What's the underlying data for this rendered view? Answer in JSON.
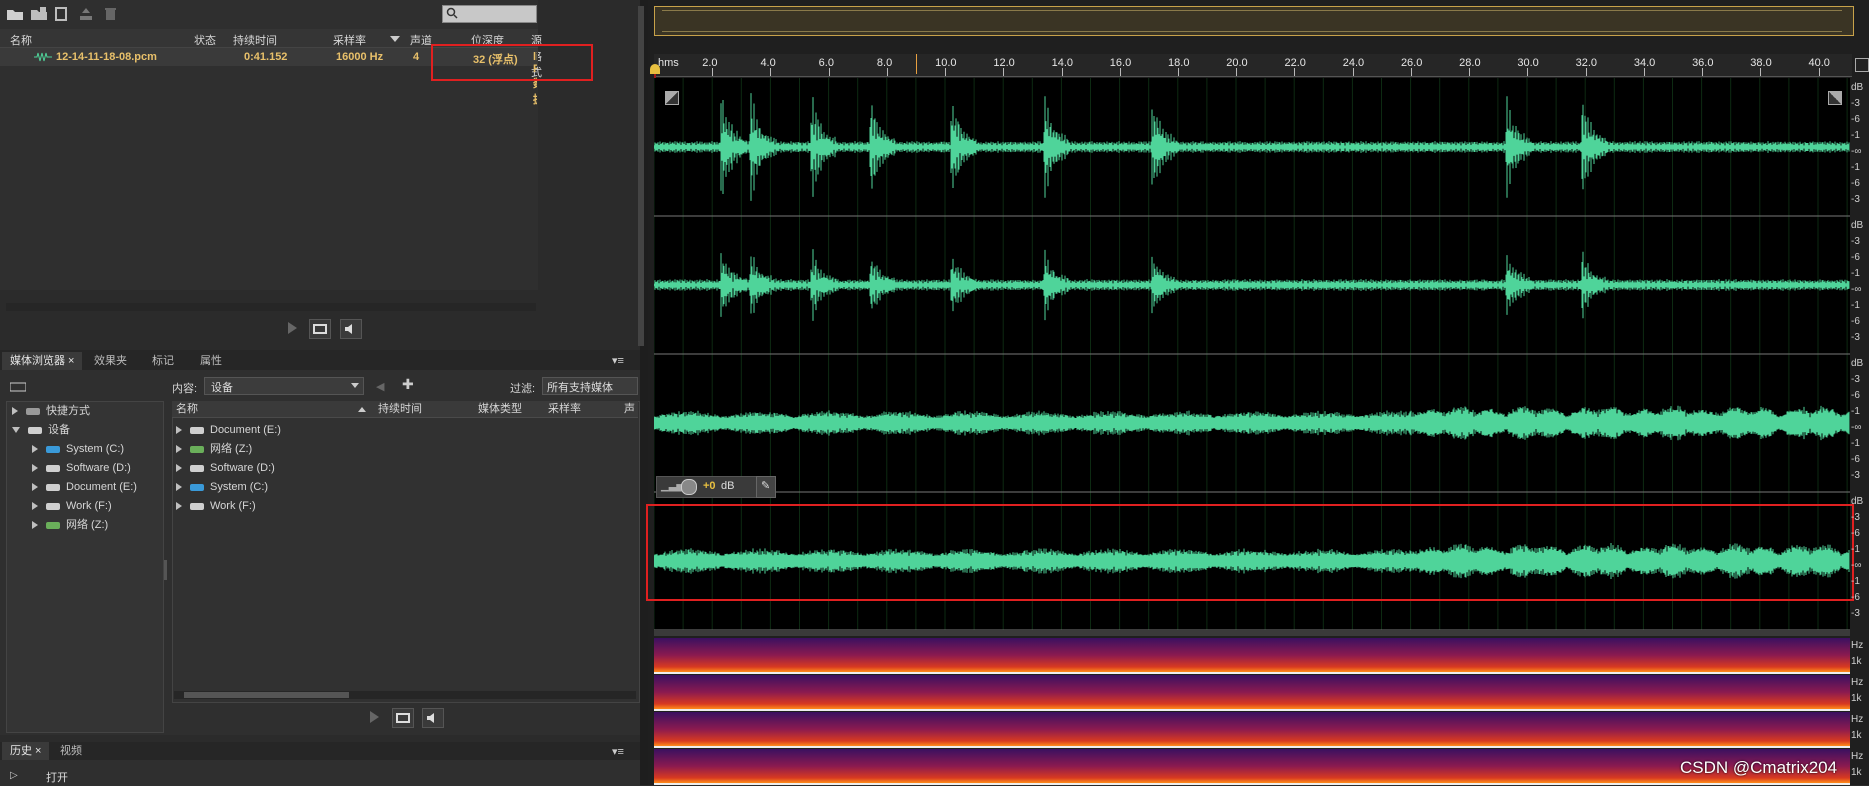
{
  "files_panel": {
    "search_placeholder": "",
    "columns": [
      "名称",
      "状态",
      "持续时间",
      "采样率",
      "声道",
      "位深度",
      "源格式"
    ],
    "row": {
      "name": "12-14-11-18-08.pcm",
      "status": "",
      "duration": "0:41.152",
      "sample_rate": "16000 Hz",
      "channels": "4",
      "bit_depth": "32 (浮点)",
      "format": "libsndfile: Raw数据,"
    }
  },
  "browser_panel": {
    "tabs": [
      "媒体浏览器",
      "效果夹",
      "标记",
      "属性"
    ],
    "content_label": "内容:",
    "content_value": "设备",
    "filter_label": "过滤:",
    "filter_value": "所有支持媒体",
    "tree": {
      "shortcuts": "快捷方式",
      "devices": "设备",
      "drives": [
        "System (C:)",
        "Software (D:)",
        "Document (E:)",
        "Work (F:)",
        "网络 (Z:)"
      ]
    },
    "list_columns": [
      "名称",
      "持续时间",
      "媒体类型",
      "采样率",
      "声"
    ],
    "list_items": [
      "Document (E:)",
      "网络 (Z:)",
      "Software (D:)",
      "System (C:)",
      "Work (F:)"
    ]
  },
  "history_panel": {
    "tabs": [
      "历史",
      "视频"
    ],
    "items": [
      "打开"
    ]
  },
  "editor": {
    "ruler_unit": "hms",
    "ruler_ticks": [
      "2.0",
      "4.0",
      "6.0",
      "8.0",
      "10.0",
      "12.0",
      "14.0",
      "16.0",
      "18.0",
      "20.0",
      "22.0",
      "24.0",
      "26.0",
      "28.0",
      "30.0",
      "32.0",
      "34.0",
      "36.0",
      "38.0",
      "40.0"
    ],
    "db_labels": [
      "dB",
      "-3",
      "-6",
      "-1",
      "-∞",
      "-1",
      "-6",
      "-3"
    ],
    "hud_gain": "+0",
    "hud_unit": "dB",
    "spec_labels": [
      "Hz",
      "1k"
    ],
    "watermark": "CSDN @Cmatrix204",
    "colors": {
      "waveform": "#4fd49a",
      "highlight": "#e02020",
      "spectral_low": "#3a1060",
      "spectral_high": "#ff8c1a"
    }
  }
}
